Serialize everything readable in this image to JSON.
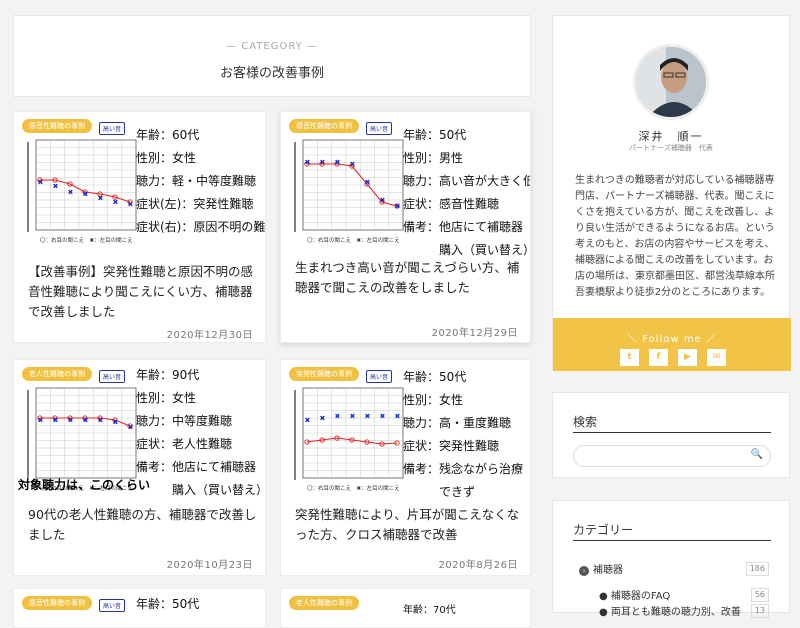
{
  "header": {
    "category_label": "— CATEGORY —",
    "title": "お客様の改善事例"
  },
  "cards": [
    {
      "tag": "感音性難聴の事例",
      "badge": "高い音",
      "info": [
        "年齢：60代",
        "性別：女性",
        "聴力：軽・中等度難聴",
        "症状(左)：突発性難聴",
        "症状(右)：原因不明の難聴"
      ],
      "legend": "〇：右耳の聞こえ　✖：左耳の聞こえ",
      "excerpt": "【改善事例】突発性難聴と原因不明の感音性難聴により聞こえにくい方、補聴器で改善しました",
      "date": "2020年12月30日"
    },
    {
      "tag": "感音性難聴の事例",
      "badge": "高い音",
      "info": [
        "年齢：50代",
        "性別：男性",
        "聴力：高い音が大きく低下",
        "症状：感音性難聴",
        "備考：他店にて補聴器",
        "　　　購入（買い替え）"
      ],
      "legend": "〇：右耳の聞こえ　✖：左耳の聞こえ",
      "excerpt": "生まれつき高い音が聞こえづらい方、補聴器で聞こえの改善をしました",
      "date": "2020年12月29日"
    },
    {
      "tag": "老人性難聴の事例",
      "badge": "高い音",
      "info": [
        "年齢：90代",
        "性別：女性",
        "聴力：中等度難聴",
        "症状：老人性難聴",
        "備考：他店にて補聴器",
        "　　　購入（買い替え）"
      ],
      "legend": "〇：右耳の聞こえ　✖：左耳の聞こえ",
      "caption": "対象聴力は、このくらい",
      "excerpt": "90代の老人性難聴の方、補聴器で改善しました",
      "date": "2020年10月23日"
    },
    {
      "tag": "突発性難聴の事例",
      "badge": "高い音",
      "info": [
        "年齢：50代",
        "性別：女性",
        "聴力：高・重度難聴",
        "症状：突発性難聴",
        "備考：残念ながら治療",
        "　　　できず"
      ],
      "legend": "〇：右耳の聞こえ　✖：左耳の聞こえ",
      "excerpt": "突発性難聴により、片耳が聞こえなくなった方、クロス補聴器で改善",
      "date": "2020年8月26日"
    },
    {
      "tag": "感音性難聴の事例",
      "badge": "高い音",
      "info": [
        "年齢：50代"
      ]
    },
    {
      "tag": "老人性難聴の事例",
      "badge": "",
      "info": [
        "年齢：70代"
      ]
    }
  ],
  "profile": {
    "name": "深井　順一",
    "role": "パートナーズ補聴器　代表",
    "description": "生まれつきの難聴者が対応している補聴器専門店、パートナーズ補聴器、代表。聞こえにくさを抱えている方が、聞こえを改善し、より良い生活ができるようになるお店。という考えのもと、お店の内容やサービスを考え、補聴器による聞こえの改善をしています。お店の場所は、東京都墨田区、都営浅草線本所吾妻橋駅より徒歩2分のところにあります。",
    "follow_label": "＼ Follow me ／",
    "social": [
      "twitter-icon",
      "facebook-icon",
      "youtube-icon",
      "mail-icon"
    ]
  },
  "search": {
    "title": "検索",
    "placeholder": ""
  },
  "categories": {
    "title": "カテゴリー",
    "items": [
      {
        "label": "補聴器",
        "count": "186",
        "level": 0
      },
      {
        "label": "補聴器のFAQ",
        "count": "56",
        "level": 1
      },
      {
        "label": "両耳とも難聴の聴力別、改善",
        "count": "13",
        "level": 1
      }
    ]
  },
  "colors": {
    "accent": "#f1c448",
    "right_ear": "#e02020",
    "left_ear": "#1a2fd6"
  }
}
